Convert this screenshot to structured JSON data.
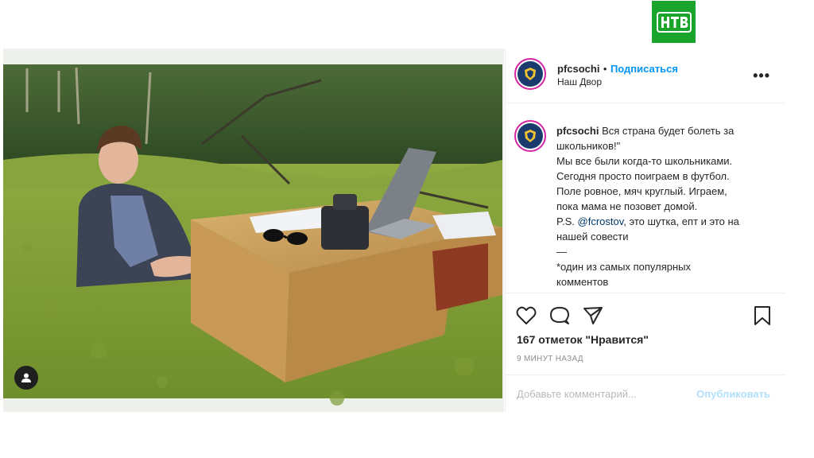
{
  "header": {
    "username": "pfcsochi",
    "separator": "•",
    "follow_label": "Подписаться",
    "location": "Наш Двор",
    "more_label": "•••"
  },
  "caption": {
    "username": "pfcsochi",
    "lines": [
      "Вся страна будет болеть за",
      "школьников!\"",
      "Мы все были когда-то школьниками.",
      "Сегодня просто поиграем в футбол.",
      "Поле ровное, мяч круглый. Играем,",
      "пока мама не позовет домой.",
      "P.S.",
      "@fcrostov",
      ", это шутка, епт и это на",
      "нашей совести",
      "—",
      "*один из самых популярных",
      "комментов"
    ]
  },
  "engagement": {
    "likes": "167 отметок \"Нравится\"",
    "time": "9 минут назад"
  },
  "comment": {
    "placeholder": "Добавьте комментарий...",
    "publish_label": "Опубликовать"
  },
  "brand": {
    "logo_text": "НТВ",
    "logo_color": "#1aa42b",
    "follow_color": "#0095f6"
  },
  "icons": [
    "user-tag-icon",
    "heart-icon",
    "comment-icon",
    "share-icon",
    "bookmark-icon",
    "more-icon",
    "ntv-logo"
  ]
}
